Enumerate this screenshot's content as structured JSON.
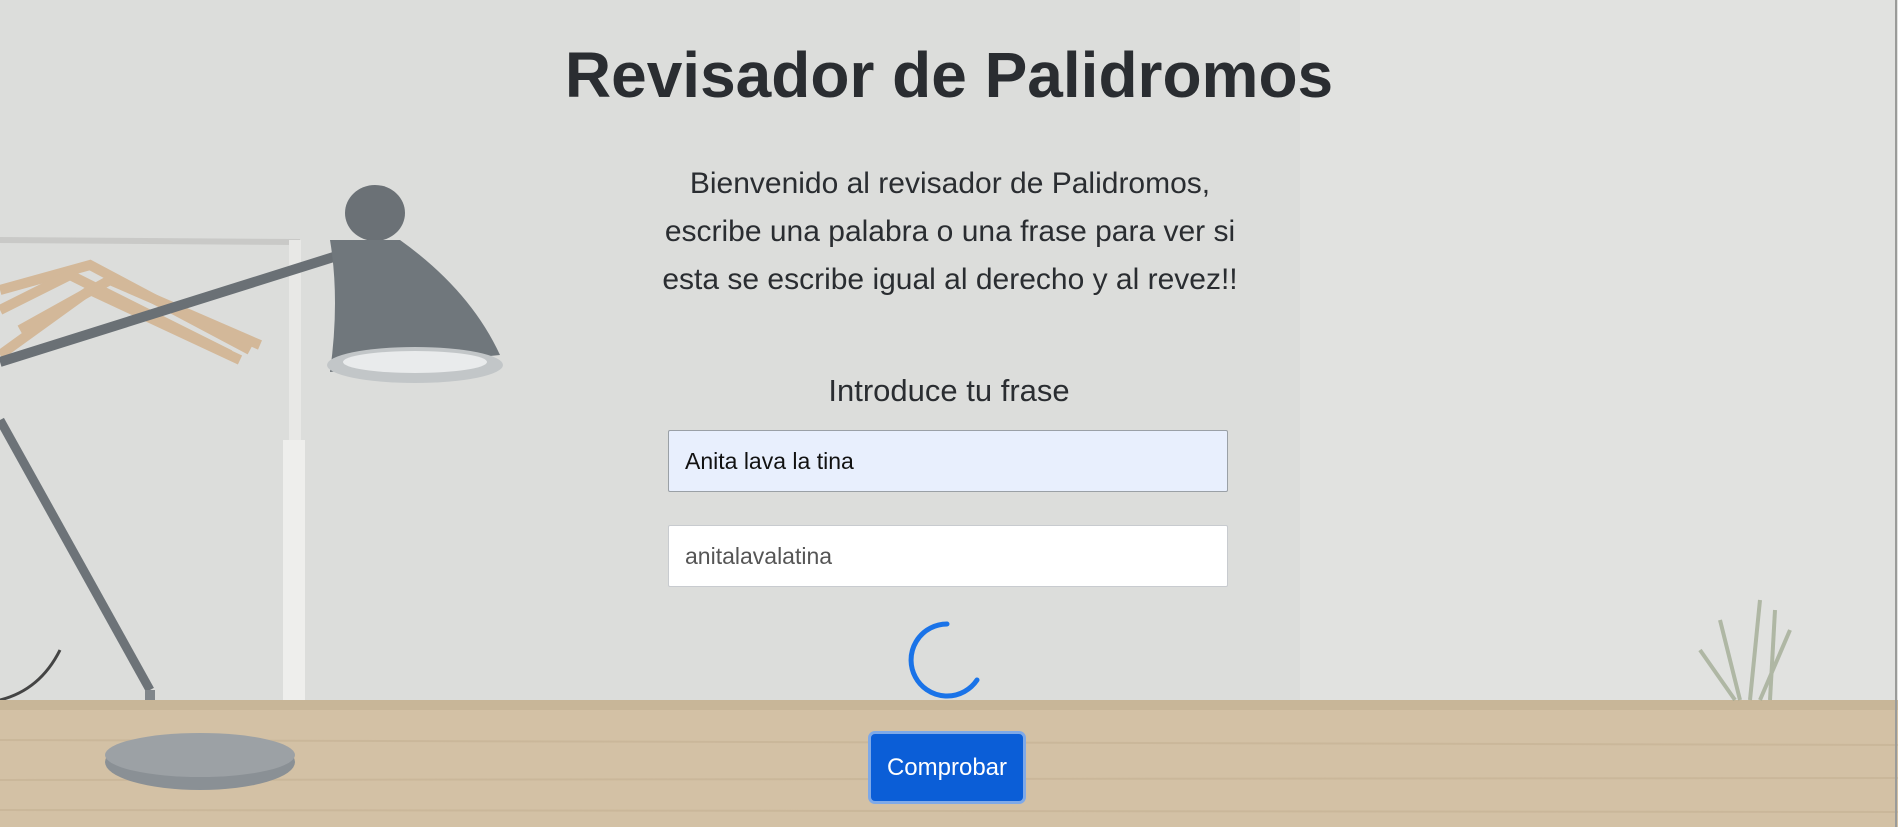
{
  "page": {
    "title": "Revisador de Palidromos",
    "intro_lines": [
      "Bienvenido al revisador de Palidromos,",
      "escribe una palabra o una frase para ver si",
      "esta se escribe igual al derecho y al revez!!"
    ],
    "input_label": "Introduce tu frase"
  },
  "form": {
    "phrase_value": "Anita lava la tina",
    "result_value": "anitalavalatina",
    "submit_label": "Comprobar"
  },
  "colors": {
    "button": "#0b5ed7",
    "spinner": "#1a73e8",
    "input_fill": "#e8effd"
  },
  "icons": {
    "loading": "spinner-icon"
  }
}
